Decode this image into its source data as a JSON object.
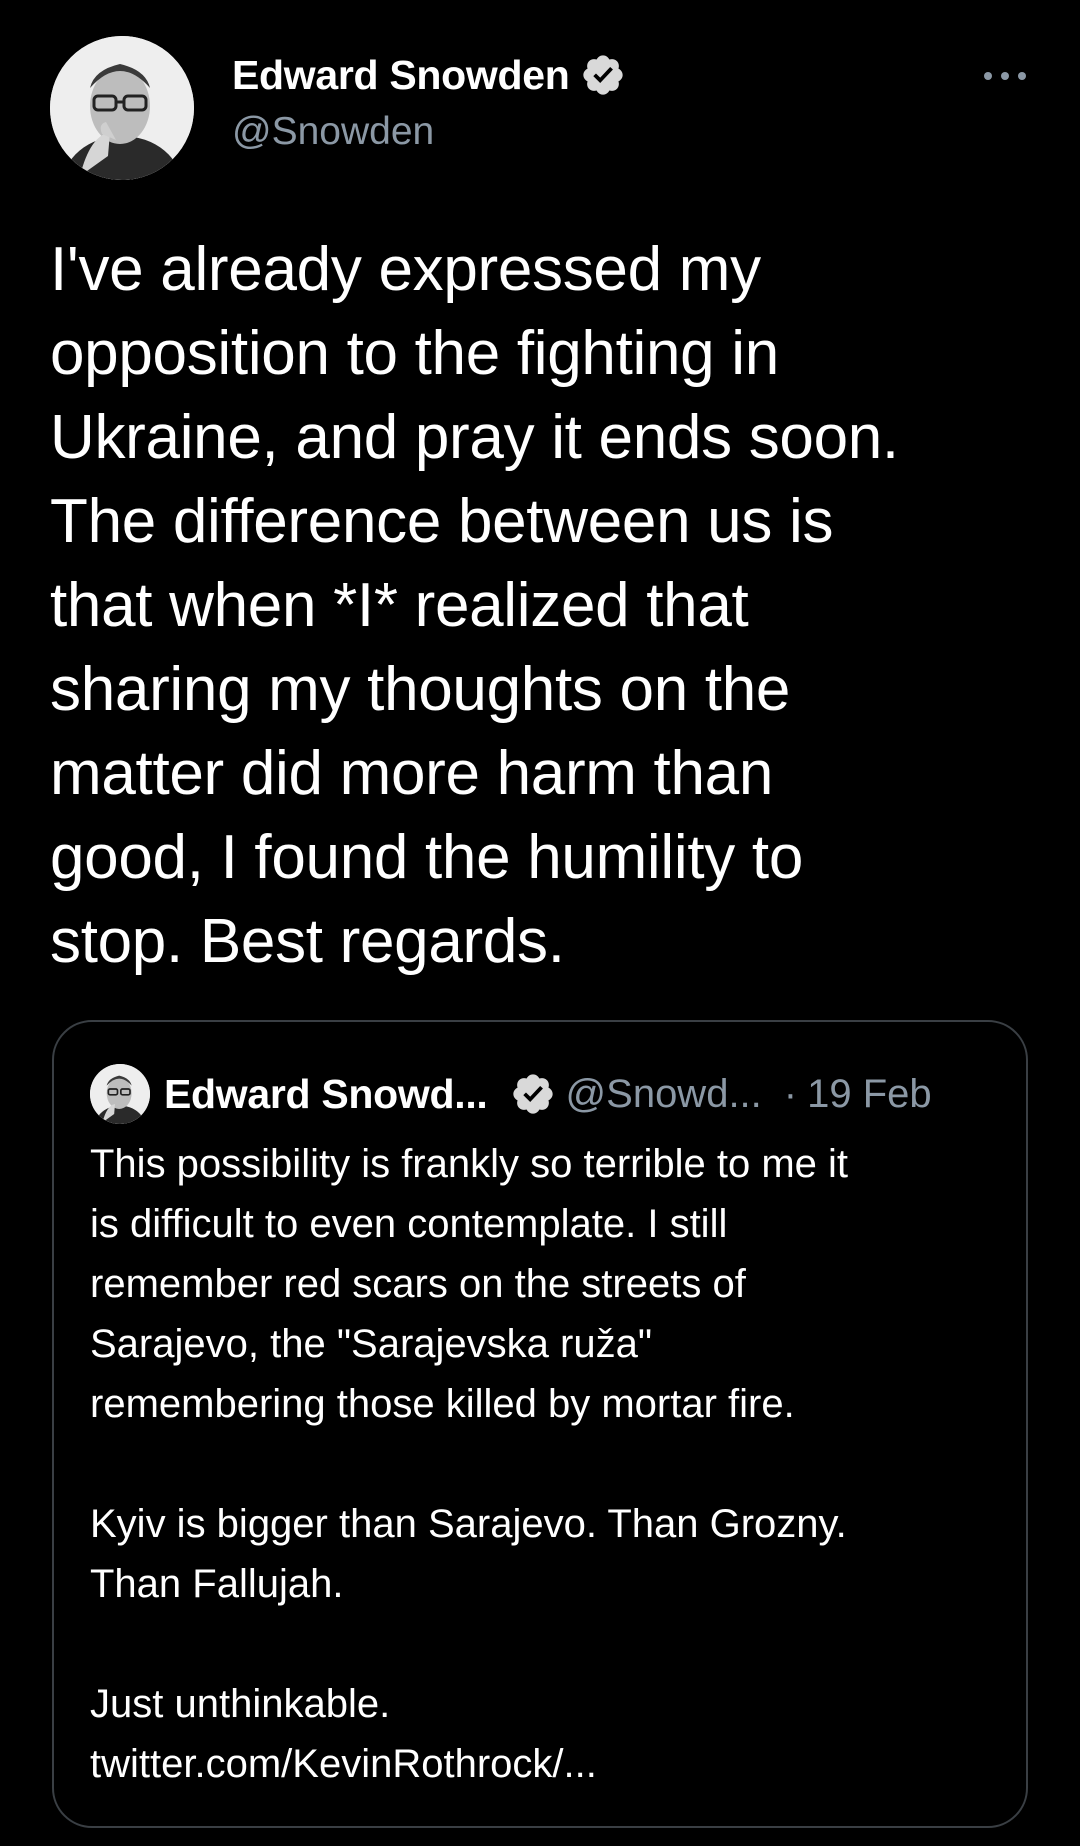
{
  "tweet": {
    "author": {
      "display_name": "Edward Snowden",
      "handle": "@Snowden",
      "verified": true,
      "avatar_icon": "profile-photo",
      "verified_icon": "verified-badge-icon"
    },
    "more_icon": "more-options-icon",
    "text": "I've already expressed my\nopposition to the fighting in\nUkraine, and pray it ends soon.\nThe difference between us is\nthat when *I* realized that\nsharing my thoughts on the\nmatter did more harm than\ngood, I found the humility to\nstop. Best regards."
  },
  "quoted_tweet": {
    "display_name": "Edward Snowd...",
    "handle": "@Snowd...",
    "separator": "·",
    "date": "19 Feb",
    "verified": true,
    "text": "This possibility is frankly so terrible to me it\nis difficult to even contemplate. I still\nremember red scars on the streets of\nSarajevo, the \"Sarajevska ruža\"\nremembering those killed by mortar fire.\n\nKyiv is bigger than Sarajevo. Than Grozny.\nThan Fallujah.\n\nJust unthinkable.\ntwitter.com/KevinRothrock/..."
  },
  "colors": {
    "background": "#000000",
    "text_primary": "#ffffff",
    "text_secondary": "#8b98a5",
    "card_border": "#3a3f44",
    "verified_badge": "#d9d9d9"
  }
}
